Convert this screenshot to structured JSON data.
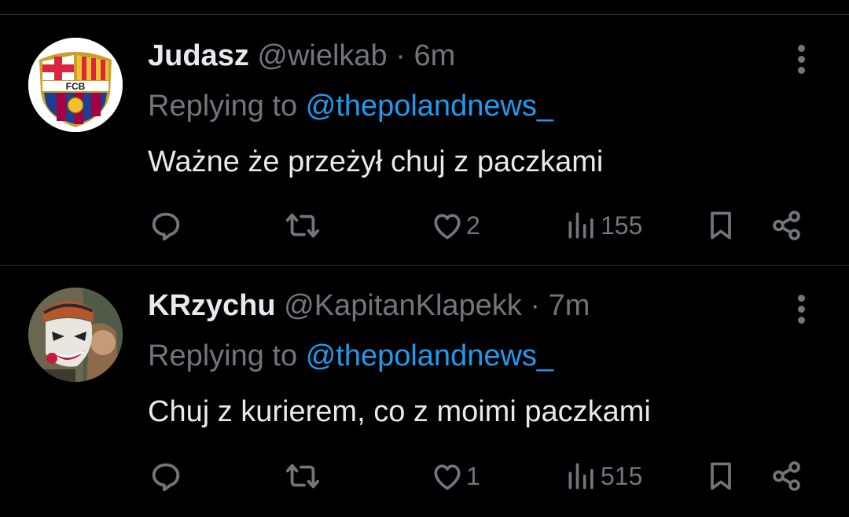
{
  "colors": {
    "background": "#000000",
    "text": "#e7e9ea",
    "muted": "#71767b",
    "link": "#1d9bf0",
    "divider": "#2f3336"
  },
  "tweets": [
    {
      "name": "Judasz",
      "handle": "@wielkab",
      "separator": "·",
      "time": "6m",
      "replying_prefix": "Replying to",
      "replying_to": "@thepolandnews_",
      "text": "Ważne że przeżył chuj z paczkami",
      "likes": "2",
      "views": "155",
      "avatar_icon": "fc-barcelona-crest",
      "avatar_text": "FCB"
    },
    {
      "name": "KRzychu",
      "handle": "@KapitanKlapekk",
      "separator": "·",
      "time": "7m",
      "replying_prefix": "Replying to",
      "replying_to": "@thepolandnews_",
      "text": "Chuj z kurierem, co z moimi paczkami",
      "likes": "1",
      "views": "515",
      "avatar_icon": "clown-avatar"
    }
  ],
  "icons": [
    "reply-icon",
    "retweet-icon",
    "like-icon",
    "views-icon",
    "bookmark-icon",
    "share-icon",
    "more-icon"
  ]
}
